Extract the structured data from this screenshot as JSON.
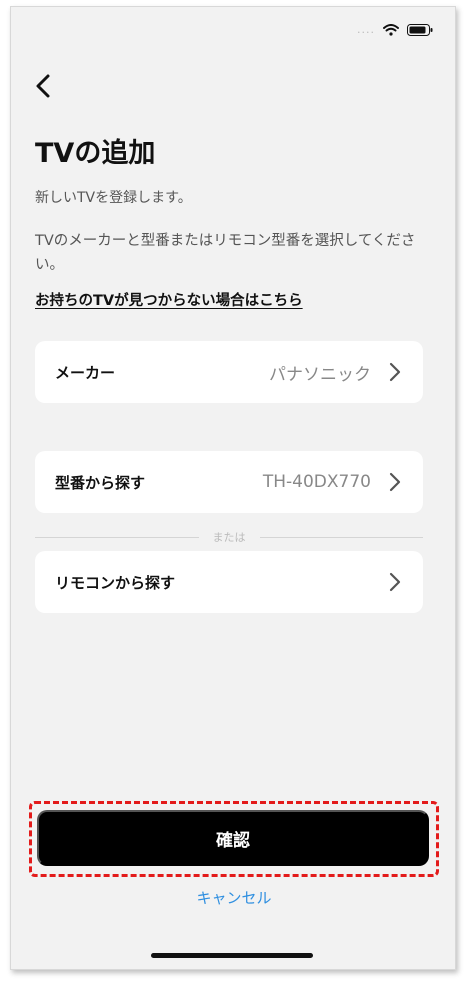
{
  "status_bar": {
    "dots": "....",
    "wifi_icon": "wifi-icon",
    "battery_icon": "battery-icon"
  },
  "header": {
    "back_icon": "chevron-left-icon",
    "title": "TVの追加"
  },
  "intro": {
    "subtitle": "新しいTVを登録します。",
    "instruction": "TVのメーカーと型番またはリモコン型番を選択してください。",
    "help_link": "お持ちのTVが見つからない場合はこちら"
  },
  "rows": {
    "maker": {
      "label": "メーカー",
      "value": "パナソニック"
    },
    "model": {
      "label": "型番から探す",
      "value": "TH-40DX770"
    },
    "separator": "または",
    "remote": {
      "label": "リモコンから探す"
    }
  },
  "actions": {
    "confirm_label": "確認",
    "cancel_label": "キャンセル"
  },
  "colors": {
    "accent_link": "#2f8fe0",
    "highlight": "#e31b1b",
    "button_bg": "#000000"
  }
}
